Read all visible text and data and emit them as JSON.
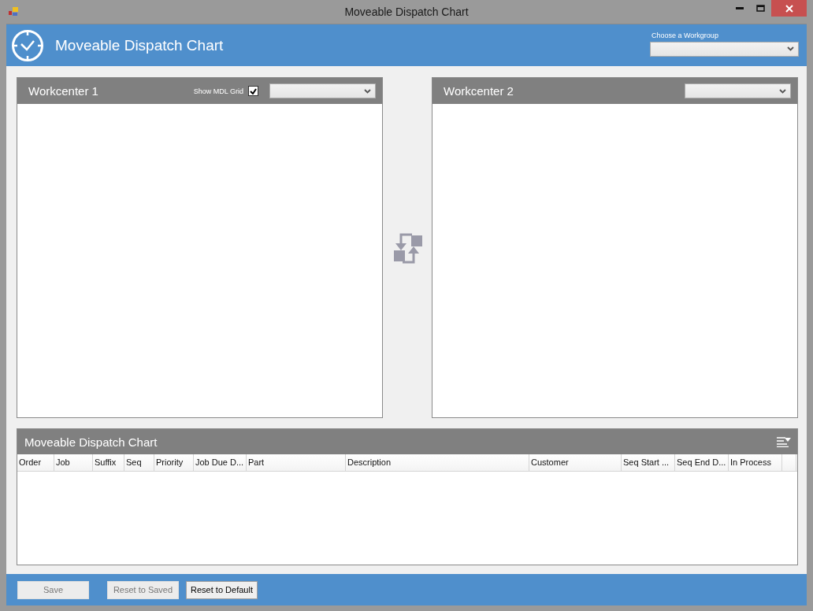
{
  "window": {
    "title": "Moveable Dispatch Chart"
  },
  "header": {
    "title": "Moveable Dispatch Chart",
    "workgroup_label": "Choose a Workgroup"
  },
  "workcenters": [
    {
      "title": "Workcenter 1",
      "show_grid": {
        "label": "Show MDL Grid",
        "checked": true
      }
    },
    {
      "title": "Workcenter 2"
    }
  ],
  "dispatch_grid": {
    "title": "Moveable Dispatch Chart",
    "columns": [
      "Order",
      "Job",
      "Suffix",
      "Seq",
      "Priority",
      "Job Due D...",
      "Part",
      "Description",
      "Customer",
      "Seq Start ...",
      "Seq End D...",
      "In Process"
    ]
  },
  "buttons": [
    {
      "label": "Save",
      "disabled": true
    },
    {
      "label": "Reset to Saved",
      "disabled": true
    },
    {
      "label": "Reset to Default",
      "disabled": false
    }
  ]
}
